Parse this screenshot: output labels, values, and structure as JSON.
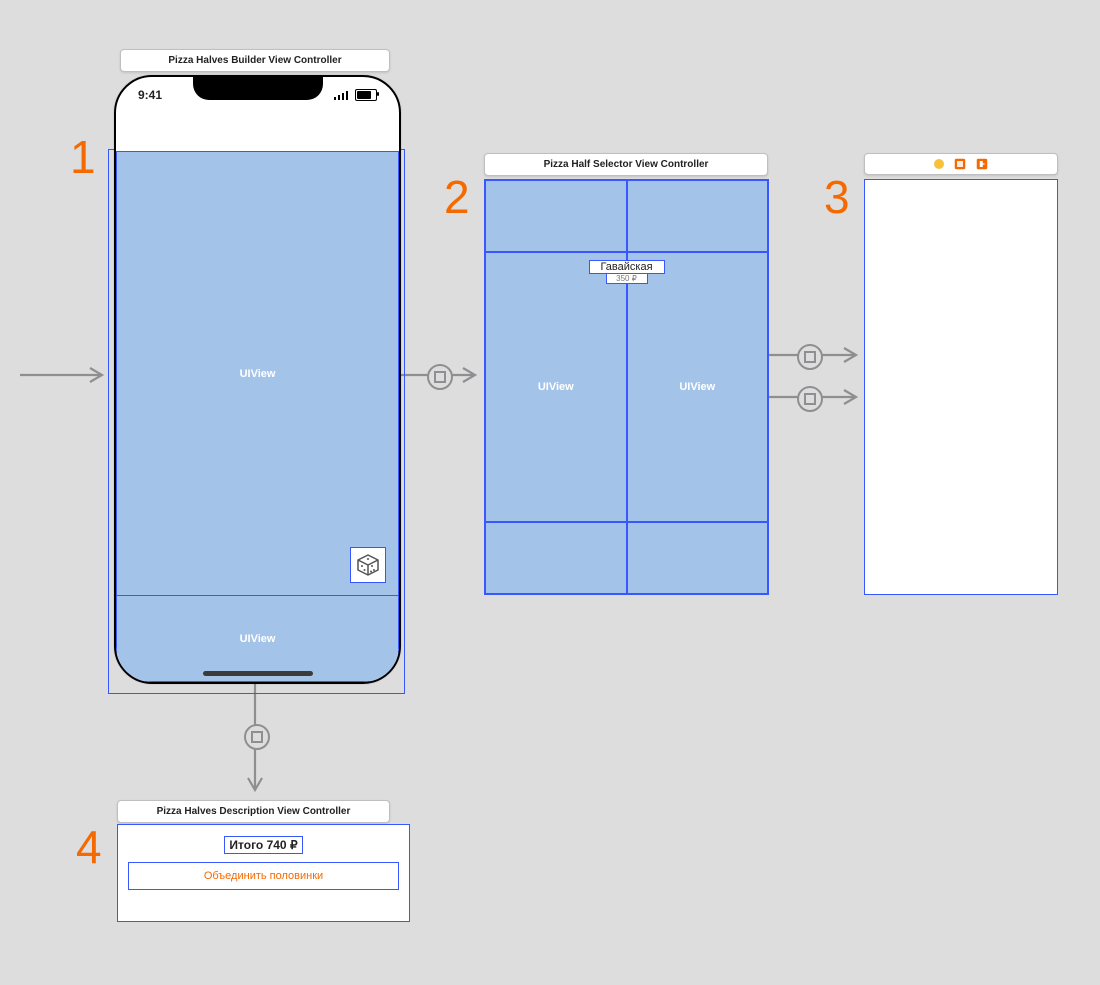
{
  "annotations": {
    "n1": "1",
    "n2": "2",
    "n3": "3",
    "n4": "4"
  },
  "scene1": {
    "title": "Pizza Halves Builder View Controller",
    "clock": "9:41",
    "main_view_label": "UIView",
    "bottom_view_label": "UIView"
  },
  "scene2": {
    "title": "Pizza Half Selector View Controller",
    "left_view_label": "UIView",
    "right_view_label": "UIView",
    "item_name": "Гавайская",
    "item_price": "350 ₽"
  },
  "scene3": {
    "icons": [
      "first-responder",
      "exit"
    ]
  },
  "scene4": {
    "title": "Pizza Halves Description View Controller",
    "total_label": "Итого 740 ₽",
    "button_label": "Объединить половинки"
  }
}
